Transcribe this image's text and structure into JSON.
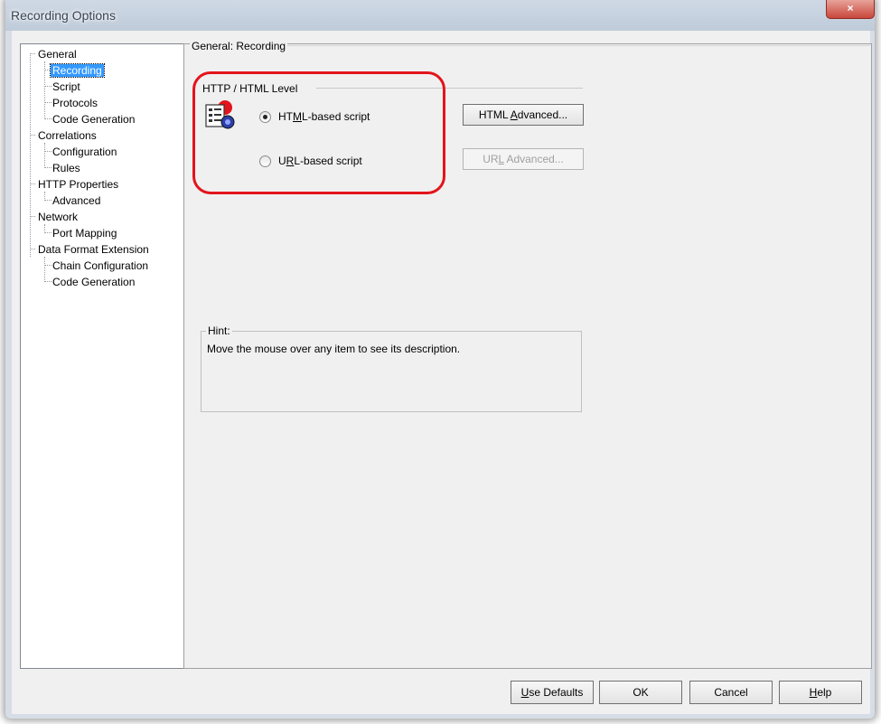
{
  "window": {
    "title": "Recording Options",
    "close_glyph": "×"
  },
  "tree": {
    "nodes": [
      {
        "label": "General",
        "level": 0
      },
      {
        "label": "Recording",
        "level": 1,
        "selected": true
      },
      {
        "label": "Script",
        "level": 1
      },
      {
        "label": "Protocols",
        "level": 1
      },
      {
        "label": "Code Generation",
        "level": 1
      },
      {
        "label": "Correlations",
        "level": 0
      },
      {
        "label": "Configuration",
        "level": 1
      },
      {
        "label": "Rules",
        "level": 1
      },
      {
        "label": "HTTP Properties",
        "level": 0
      },
      {
        "label": "Advanced",
        "level": 1
      },
      {
        "label": "Network",
        "level": 0
      },
      {
        "label": "Port Mapping",
        "level": 1
      },
      {
        "label": "Data Format Extension",
        "level": 0
      },
      {
        "label": "Chain Configuration",
        "level": 1
      },
      {
        "label": "Code Generation",
        "level": 1
      }
    ]
  },
  "panel": {
    "title": "General: Recording",
    "group_title": "HTTP / HTML Level",
    "icon": "script-document-icon",
    "radios": [
      {
        "pre": "HT",
        "underline": "M",
        "post": "L-based script",
        "checked": true
      },
      {
        "pre": "U",
        "underline": "R",
        "post": "L-based script",
        "checked": false
      }
    ],
    "html_advanced": {
      "pre": "HTML ",
      "underline": "A",
      "post": "dvanced..."
    },
    "url_advanced": {
      "pre": "UR",
      "underline": "L",
      "post": " Advanced..."
    },
    "hint_title": "Hint:",
    "hint_text": "Move the mouse over any item to see its description."
  },
  "footer": {
    "use_defaults": {
      "pre": "",
      "underline": "U",
      "post": "se Defaults"
    },
    "ok": "OK",
    "cancel": "Cancel",
    "help": {
      "pre": "",
      "underline": "H",
      "post": "elp"
    }
  },
  "colors": {
    "annotation": "#e3141b",
    "selection": "#3399ff",
    "dialog_bg": "#f0f0f0"
  }
}
